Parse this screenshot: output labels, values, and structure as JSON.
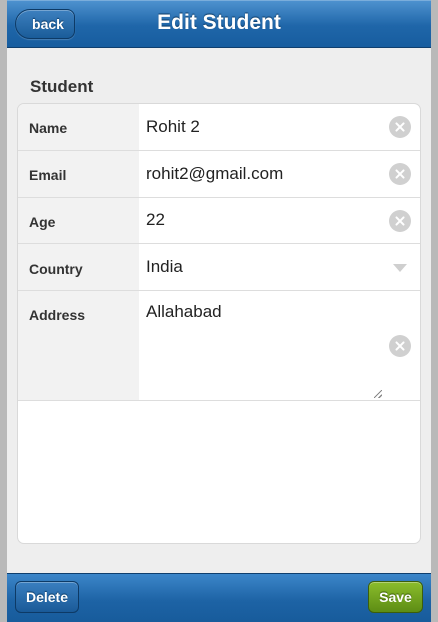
{
  "header": {
    "title": "Edit Student",
    "back_label": "back"
  },
  "section": {
    "label": "Student"
  },
  "form": {
    "name": {
      "label": "Name",
      "value": "Rohit 2"
    },
    "email": {
      "label": "Email",
      "value": "rohit2@gmail.com"
    },
    "age": {
      "label": "Age",
      "value": "22"
    },
    "country": {
      "label": "Country",
      "value": "India"
    },
    "address": {
      "label": "Address",
      "value": "Allahabad"
    }
  },
  "footer": {
    "delete_label": "Delete",
    "save_label": "Save"
  },
  "icons": {
    "clear": "clear-icon",
    "dropdown": "chevron-down-icon"
  },
  "colors": {
    "header_blue": "#1f66a9",
    "save_green": "#5d8d14"
  }
}
